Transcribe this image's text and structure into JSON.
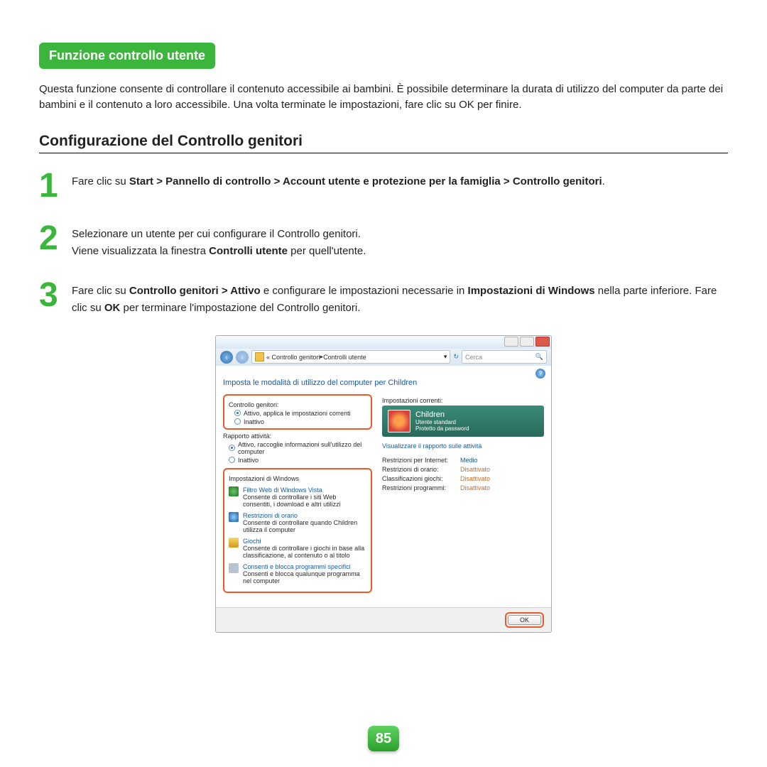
{
  "section_title": "Funzione controllo utente",
  "intro": "Questa funzione consente di controllare il contenuto accessibile ai bambini. È possibile determinare la durata di utilizzo del computer da parte dei bambini e il contenuto a loro accessibile. Una volta terminate le impostazioni, fare clic su OK per finire.",
  "subheading": "Configurazione del Controllo genitori",
  "steps": {
    "s1": {
      "num": "1",
      "pre": "Fare clic su ",
      "bold": "Start > Pannello di controllo > Account utente e protezione per la famiglia > Controllo genitori",
      "post": "."
    },
    "s2": {
      "num": "2",
      "l1": "Selezionare un utente per cui configurare il Controllo genitori.",
      "l2a": "Viene visualizzata la finestra ",
      "l2b": "Controlli utente",
      "l2c": " per quell'utente."
    },
    "s3": {
      "num": "3",
      "pre": "Fare clic su ",
      "b1": "Controllo genitori > Attivo",
      "mid": " e configurare le impostazioni necessarie in ",
      "b2": "Impostazioni di Windows",
      "post1": " nella parte inferiore. Fare clic su ",
      "b3": "OK",
      "post2": " per terminare l'impostazione del Controllo genitori."
    }
  },
  "window": {
    "breadcrumb_a": "« Controllo genitori ",
    "breadcrumb_b": " Controlli utente",
    "search_placeholder": "Cerca",
    "heading": "Imposta le modalità di utilizzo del computer per Children",
    "grp_pc": "Controllo genitori:",
    "pc_on": "Attivo, applica le impostazioni correnti",
    "pc_off": "Inattivo",
    "grp_act": "Rapporto attività:",
    "act_on": "Attivo, raccoglie informazioni sull'utilizzo del computer",
    "act_off": "Inattivo",
    "grp_ws": "Impostazioni di Windows",
    "ws_web_t": "Filtro Web di Windows Vista",
    "ws_web_d": "Consente di controllare i siti Web consentiti, i download e altri utilizzi",
    "ws_time_t": "Restrizioni di orario",
    "ws_time_d": "Consente di controllare quando Children utilizza il computer",
    "ws_game_t": "Giochi",
    "ws_game_d": "Consente di controllare i giochi in base alla classificazione, al contenuto o al titolo",
    "ws_prog_t": "Consenti e blocca programmi specifici",
    "ws_prog_d": "Consenti e blocca qualunque programma nel computer",
    "cur_heading": "Impostazioni correnti:",
    "user_name": "Children",
    "user_type": "Utente standard",
    "user_pw": "Protetto da password",
    "view_report": "Visualizzare il rapporto sulle attività",
    "r_web_l": "Restrizioni per Internet:",
    "r_web_v": "Medio",
    "r_time_l": "Restrizioni di orario:",
    "r_time_v": "Disattivato",
    "r_game_l": "Classificazioni giochi:",
    "r_game_v": "Disattivato",
    "r_prog_l": "Restrizioni programmi:",
    "r_prog_v": "Disattivato",
    "ok": "OK"
  },
  "page_number": "85"
}
